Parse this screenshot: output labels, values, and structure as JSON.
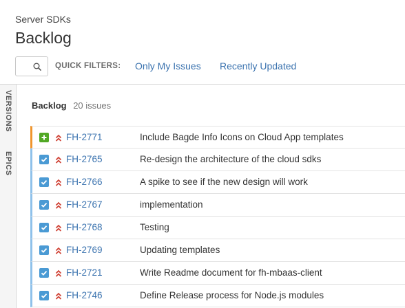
{
  "header": {
    "project_name": "Server SDKs",
    "title": "Backlog"
  },
  "quick_filters": {
    "label": "QUICK FILTERS:",
    "items": [
      "Only My Issues",
      "Recently Updated"
    ]
  },
  "side_tabs": [
    "VERSIONS",
    "EPICS"
  ],
  "backlog": {
    "title": "Backlog",
    "count": "20 issues",
    "issues": [
      {
        "type": "story",
        "priority": "highest",
        "key": "FH-2771",
        "summary": "Include Bagde Info Icons on Cloud App templates"
      },
      {
        "type": "task",
        "priority": "highest",
        "key": "FH-2765",
        "summary": "Re-design the architecture of the cloud sdks"
      },
      {
        "type": "task",
        "priority": "highest",
        "key": "FH-2766",
        "summary": "A spike to see if the new design will work"
      },
      {
        "type": "task",
        "priority": "highest",
        "key": "FH-2767",
        "summary": "implementation"
      },
      {
        "type": "task",
        "priority": "highest",
        "key": "FH-2768",
        "summary": "Testing"
      },
      {
        "type": "task",
        "priority": "highest",
        "key": "FH-2769",
        "summary": "Updating templates"
      },
      {
        "type": "task",
        "priority": "highest",
        "key": "FH-2721",
        "summary": "Write Readme document for fh-mbaas-client"
      },
      {
        "type": "task",
        "priority": "highest",
        "key": "FH-2746",
        "summary": "Define Release process for Node.js modules"
      }
    ]
  },
  "colors": {
    "link": "#3b73af",
    "story": "#51a825",
    "task": "#4a9ad4",
    "priority_highest": "#d04437",
    "flag_first_row": "#f0952d",
    "row_stripe": "#8fc1ea"
  }
}
